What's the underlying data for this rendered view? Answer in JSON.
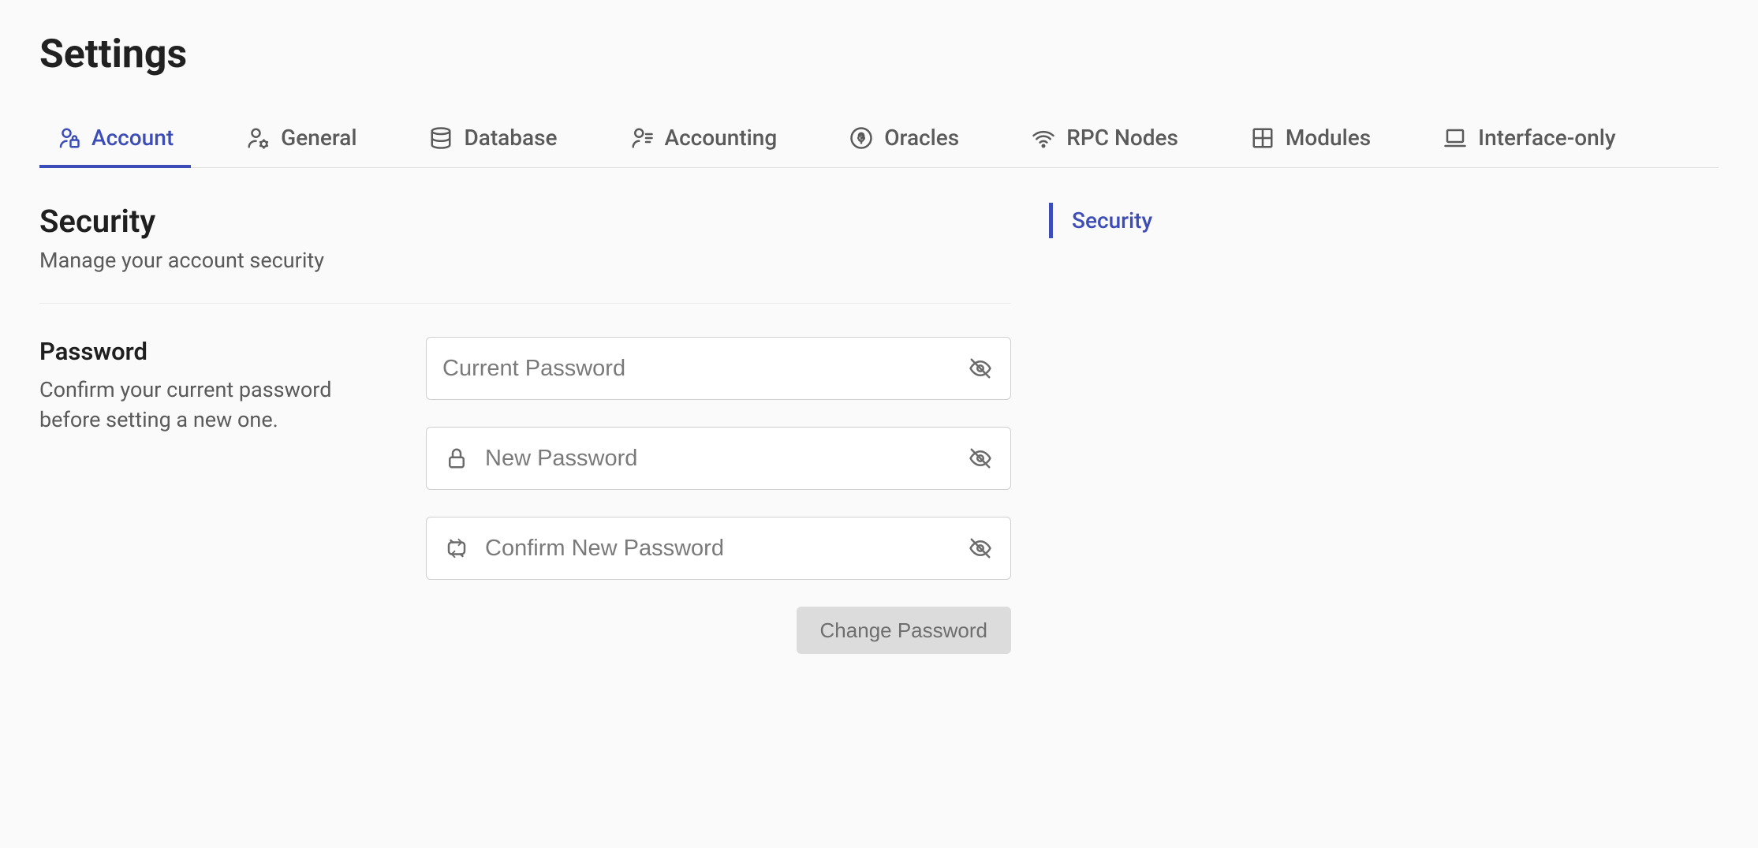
{
  "page": {
    "title": "Settings"
  },
  "tabs": [
    {
      "label": "Account",
      "icon": "account-lock-icon",
      "active": true
    },
    {
      "label": "General",
      "icon": "account-gear-icon",
      "active": false
    },
    {
      "label": "Database",
      "icon": "database-icon",
      "active": false
    },
    {
      "label": "Accounting",
      "icon": "account-list-icon",
      "active": false
    },
    {
      "label": "Oracles",
      "icon": "oracle-icon",
      "active": false
    },
    {
      "label": "RPC Nodes",
      "icon": "wifi-icon",
      "active": false
    },
    {
      "label": "Modules",
      "icon": "grid-icon",
      "active": false
    },
    {
      "label": "Interface-only",
      "icon": "laptop-icon",
      "active": false
    }
  ],
  "section": {
    "title": "Security",
    "subtitle": "Manage your account security"
  },
  "password": {
    "heading": "Password",
    "description": "Confirm your current password before setting a new one.",
    "fields": {
      "current": {
        "placeholder": "Current Password",
        "value": ""
      },
      "new": {
        "placeholder": "New Password",
        "value": ""
      },
      "confirm": {
        "placeholder": "Confirm New Password",
        "value": ""
      }
    },
    "button_label": "Change Password"
  },
  "sidenav": {
    "items": [
      {
        "label": "Security",
        "active": true
      }
    ]
  },
  "colors": {
    "accent": "#3d4db7"
  }
}
